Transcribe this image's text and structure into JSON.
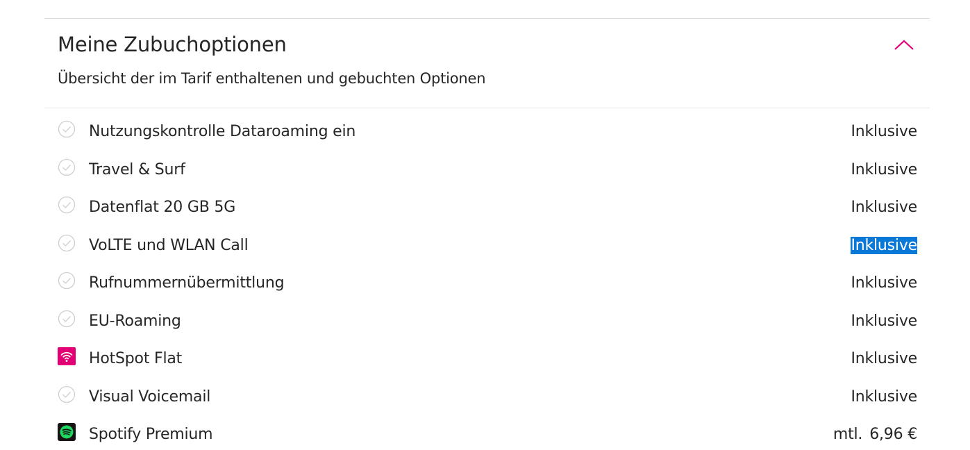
{
  "section": {
    "title": "Meine Zubuchoptionen",
    "subtitle": "Übersicht der im Tarif enthaltenen und gebuchten Optionen",
    "accent_color": "#e20074",
    "collapse_icon": "chevron-up-icon"
  },
  "options": [
    {
      "label": "Nutzungskontrolle Dataroaming ein",
      "value": "Inklusive",
      "icon": "check-circle-icon"
    },
    {
      "label": "Travel & Surf",
      "value": "Inklusive",
      "icon": "check-circle-icon"
    },
    {
      "label": "Datenflat 20 GB 5G",
      "value": "Inklusive",
      "icon": "check-circle-icon"
    },
    {
      "label": "VoLTE und WLAN Call",
      "value": "Inklusive",
      "icon": "check-circle-icon",
      "selected": true
    },
    {
      "label": "Rufnummernübermittlung",
      "value": "Inklusive",
      "icon": "check-circle-icon"
    },
    {
      "label": "EU-Roaming",
      "value": "Inklusive",
      "icon": "check-circle-icon"
    },
    {
      "label": "HotSpot Flat",
      "value": "Inklusive",
      "icon": "wifi-icon"
    },
    {
      "label": "Visual Voicemail",
      "value": "Inklusive",
      "icon": "check-circle-icon"
    },
    {
      "label": "Spotify Premium",
      "value_prefix": "mtl.",
      "value": "6,96 €",
      "icon": "spotify-icon"
    }
  ],
  "colors": {
    "check_gray": "#cfcfcf",
    "magenta": "#e20074",
    "spotify_bg": "#191414",
    "spotify_green": "#1ed760",
    "selection": "#0a78d7"
  }
}
